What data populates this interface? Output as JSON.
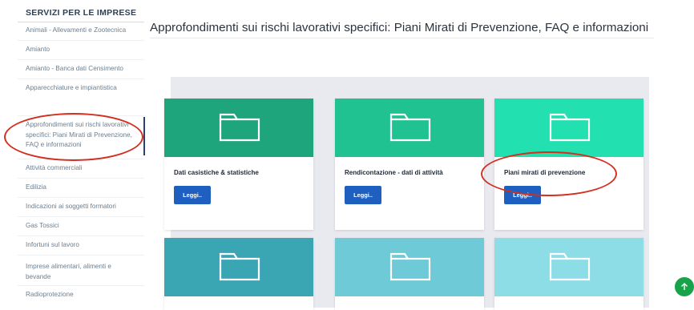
{
  "sidebar": {
    "title": "SERVIZI PER LE IMPRESE",
    "items": [
      {
        "label": "Animali - Allevamenti e Zootecnica"
      },
      {
        "label": "Amianto"
      },
      {
        "label": "Amianto - Banca dati Censimento"
      },
      {
        "label": "Apparecchiature e impiantistica"
      },
      {
        "label": "Approfondimenti sui rischi lavorativi specifici: Piani Mirati di Prevenzione, FAQ e informazioni"
      },
      {
        "label": "Attività commerciali"
      },
      {
        "label": "Edilizia"
      },
      {
        "label": "Indicazioni ai soggetti formatori"
      },
      {
        "label": "Gas Tossici"
      },
      {
        "label": "Infortuni sul lavoro"
      },
      {
        "label": "Imprese alimentari, alimenti e bevande"
      },
      {
        "label": "Radioprotezione"
      }
    ]
  },
  "main": {
    "title": "Approfondimenti sui rischi lavorativi specifici: Piani Mirati di Prevenzione, FAQ e informazioni",
    "cards": [
      {
        "title": "Dati casistiche & statistiche",
        "button": "Leggi..",
        "color": "#1fa57c"
      },
      {
        "title": "Rendicontazione - dati di attività",
        "button": "Leggi..",
        "color": "#20c292"
      },
      {
        "title": "Piani mirati di prevenzione",
        "button": "Leggi..",
        "color": "#23e0b1"
      },
      {
        "title": "",
        "button": "",
        "color": "#3aa6b3"
      },
      {
        "title": "",
        "button": "",
        "color": "#6ecad6"
      },
      {
        "title": "",
        "button": "",
        "color": "#8cdde6"
      }
    ]
  },
  "colors": {
    "accent_blue": "#1f5fbf",
    "annotation_red": "#d42e1f",
    "fab_green": "#18a34a"
  },
  "fab": {
    "icon": "arrow-up-icon"
  }
}
